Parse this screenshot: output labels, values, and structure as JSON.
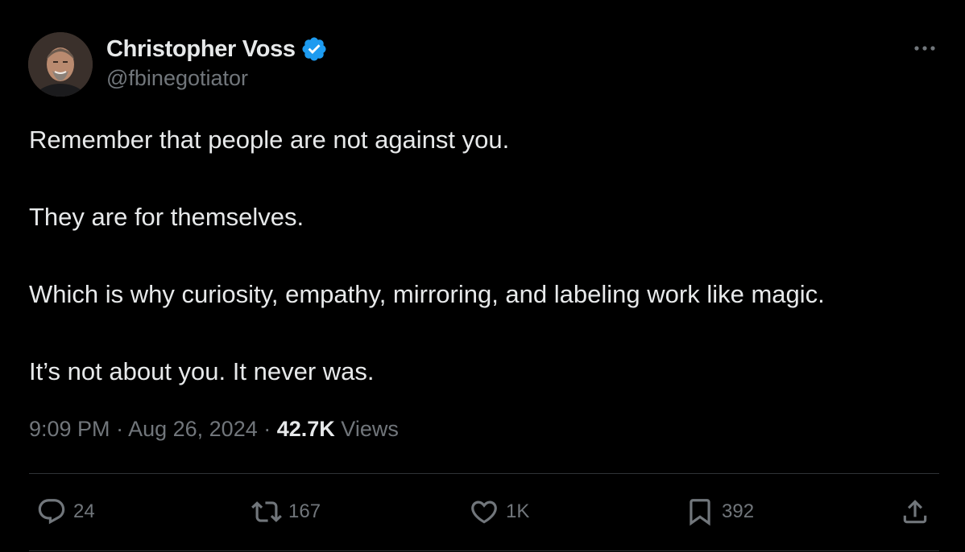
{
  "author": {
    "display_name": "Christopher Voss",
    "handle": "@fbinegotiator",
    "verified": true
  },
  "tweet": {
    "paragraphs": [
      "Remember that people are not against you.",
      "They are for themselves.",
      "Which is why curiosity, empathy, mirroring, and labeling work like magic.",
      "It’s not about you. It never was."
    ],
    "time": "9:09 PM",
    "separator": " · ",
    "date": "Aug 26, 2024",
    "views_count": "42.7K",
    "views_label": " Views"
  },
  "actions": {
    "replies": "24",
    "retweets": "167",
    "likes": "1K",
    "bookmarks": "392"
  },
  "icons": {
    "verified": "verified-badge-icon",
    "more": "more-options-icon",
    "reply": "reply-icon",
    "retweet": "retweet-icon",
    "like": "heart-icon",
    "bookmark": "bookmark-icon",
    "share": "share-icon"
  },
  "colors": {
    "background": "#000000",
    "primary_text": "#e7e9ea",
    "secondary_text": "#71767b",
    "verified_blue": "#1d9bf0",
    "divider": "#2f3336"
  }
}
